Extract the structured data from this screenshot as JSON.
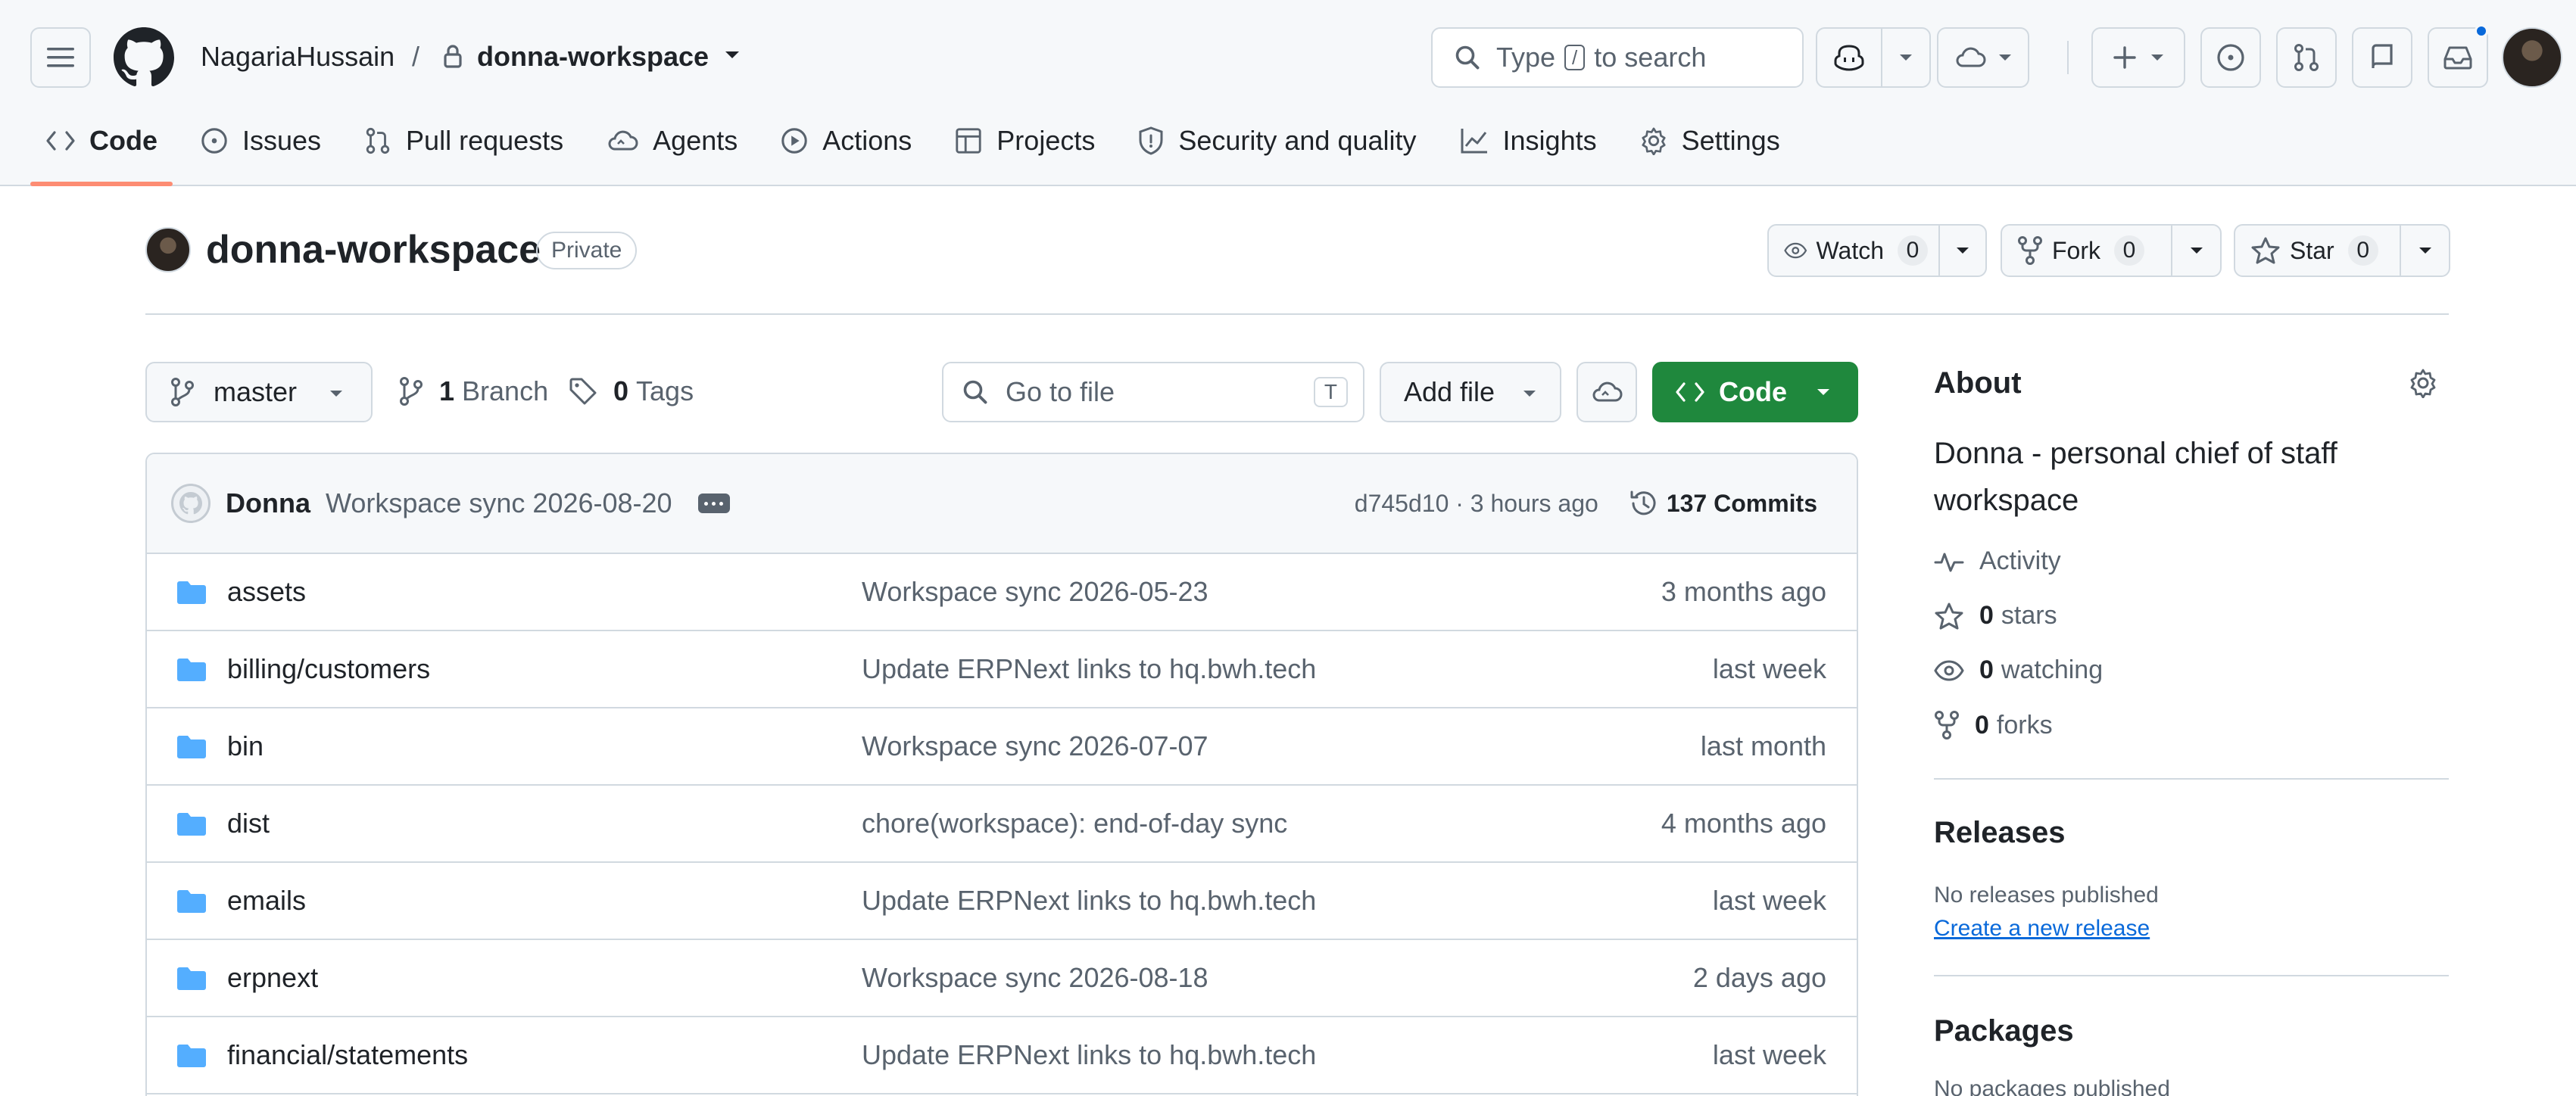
{
  "header": {
    "owner": "NagariaHussain",
    "separator": "/",
    "repo": "donna-workspace",
    "search_prefix": "Type",
    "search_key": "/",
    "search_suffix": "to search"
  },
  "tabs": [
    {
      "label": "Code",
      "icon": "code-icon",
      "active": true
    },
    {
      "label": "Issues",
      "icon": "issue-icon"
    },
    {
      "label": "Pull requests",
      "icon": "pull-request-icon"
    },
    {
      "label": "Agents",
      "icon": "agents-icon"
    },
    {
      "label": "Actions",
      "icon": "play-icon"
    },
    {
      "label": "Projects",
      "icon": "table-icon"
    },
    {
      "label": "Security and quality",
      "icon": "shield-icon"
    },
    {
      "label": "Insights",
      "icon": "graph-icon"
    },
    {
      "label": "Settings",
      "icon": "gear-icon"
    }
  ],
  "repo_header": {
    "name": "donna-workspace",
    "visibility": "Private",
    "watch": {
      "label": "Watch",
      "count": "0"
    },
    "fork": {
      "label": "Fork",
      "count": "0"
    },
    "star": {
      "label": "Star",
      "count": "0"
    }
  },
  "file_nav": {
    "branch": "master",
    "branches_count": "1",
    "branches_label": "Branch",
    "tags_count": "0",
    "tags_label": "Tags",
    "goto_placeholder": "Go to file",
    "goto_key": "T",
    "add_file": "Add file",
    "code_button": "Code"
  },
  "latest_commit": {
    "author": "Donna",
    "message": "Workspace sync 2026-08-20",
    "sha_time": "d745d10 · 3 hours ago",
    "commits": "137 Commits"
  },
  "files": [
    {
      "name": "assets",
      "message": "Workspace sync 2026-05-23",
      "date": "3 months ago"
    },
    {
      "name": "billing/customers",
      "message": "Update ERPNext links to hq.bwh.tech",
      "date": "last week"
    },
    {
      "name": "bin",
      "message": "Workspace sync 2026-07-07",
      "date": "last month"
    },
    {
      "name": "dist",
      "message": "chore(workspace): end-of-day sync",
      "date": "4 months ago"
    },
    {
      "name": "emails",
      "message": "Update ERPNext links to hq.bwh.tech",
      "date": "last week"
    },
    {
      "name": "erpnext",
      "message": "Workspace sync 2026-08-18",
      "date": "2 days ago"
    },
    {
      "name": "financial/statements",
      "message": "Update ERPNext links to hq.bwh.tech",
      "date": "last week"
    }
  ],
  "about": {
    "title": "About",
    "description": "Donna - personal chief of staff workspace",
    "activity": "Activity",
    "stars_count": "0",
    "stars_label": "stars",
    "watching_count": "0",
    "watching_label": "watching",
    "forks_count": "0",
    "forks_label": "forks"
  },
  "releases": {
    "title": "Releases",
    "note": "No releases published",
    "link": "Create a new release"
  },
  "packages": {
    "title": "Packages",
    "note": "No packages published"
  },
  "colors": {
    "accent_green": "#1f883d",
    "link_blue": "#0969da",
    "folder_blue": "#54aeff",
    "tab_underline": "#fd8c73"
  }
}
